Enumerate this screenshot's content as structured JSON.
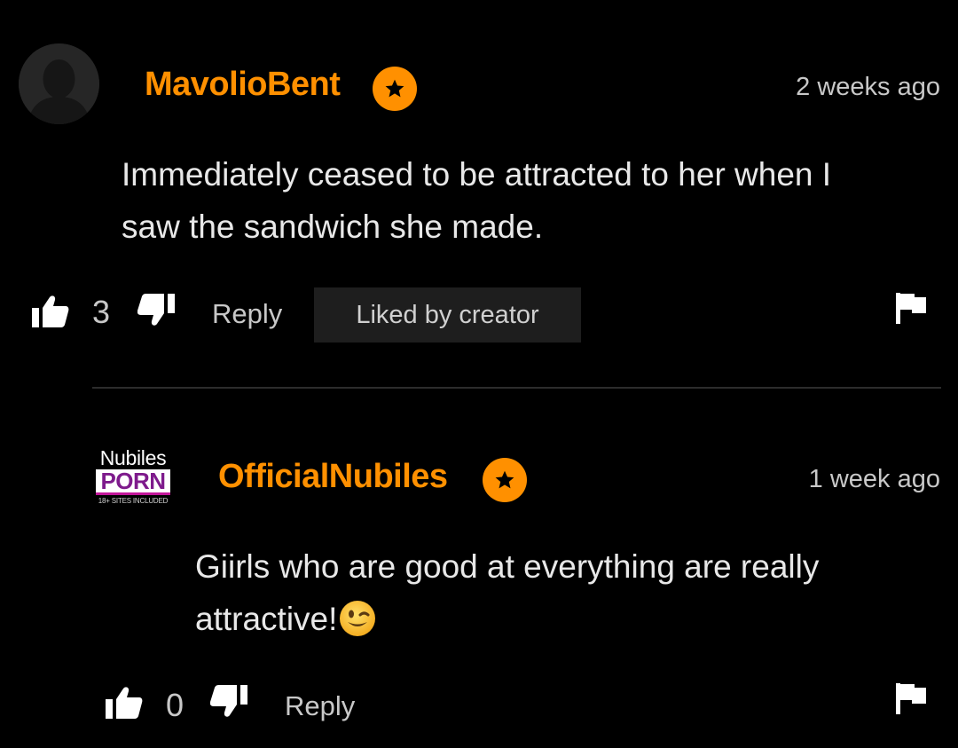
{
  "comments": [
    {
      "username": "MavolioBent",
      "timestamp": "2 weeks ago",
      "text_line1": "Immediately ceased to be attracted to her when I",
      "text_line2": "saw the sandwich she made.",
      "likes": "3",
      "reply_label": "Reply",
      "liked_by_creator": "Liked by creator"
    },
    {
      "username": "OfficialNubiles",
      "timestamp": "1 week ago",
      "text_line1": "Giirls who are good at everything are really",
      "text_line2": "attractive!",
      "emoji": "winking-face",
      "likes": "0",
      "reply_label": "Reply",
      "logo": {
        "top": "Nubiles",
        "middle": "PORN",
        "bottom": "18+ SITES INCLUDED"
      }
    }
  ],
  "colors": {
    "background": "#000000",
    "accent": "#ff9000",
    "text": "#e8e8e8",
    "muted": "#c8c8c8",
    "badge_bg": "#1e1e1e"
  },
  "icons": [
    "default-avatar-icon",
    "star-icon",
    "thumbs-up-icon",
    "thumbs-down-icon",
    "flag-icon",
    "winking-emoji-icon"
  ]
}
